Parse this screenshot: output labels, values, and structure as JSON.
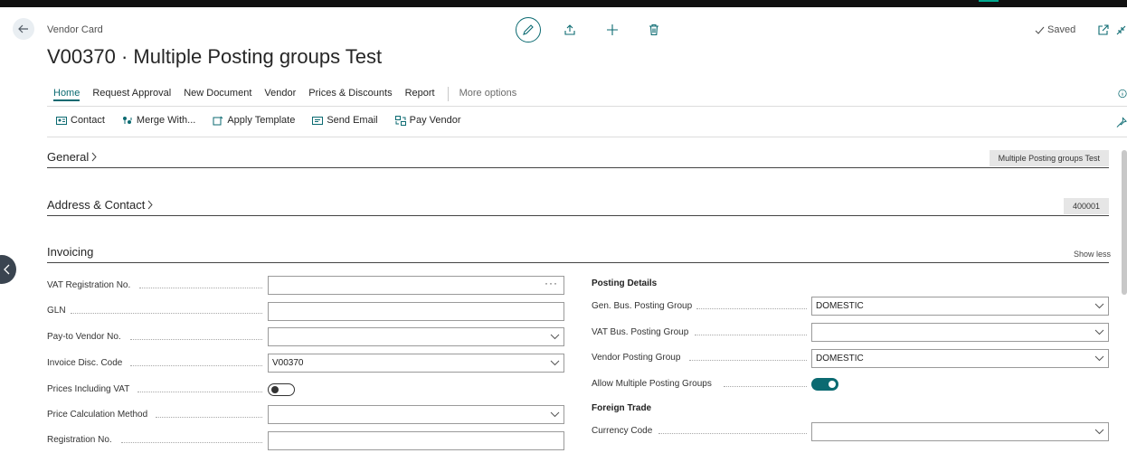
{
  "header": {
    "caption": "Vendor Card",
    "title": "V00370 · Multiple Posting groups Test",
    "saved_label": "Saved"
  },
  "menu": {
    "items": [
      "Home",
      "Request Approval",
      "New Document",
      "Vendor",
      "Prices & Discounts",
      "Report"
    ],
    "more_options": "More options"
  },
  "actions": {
    "items": [
      "Contact",
      "Merge With...",
      "Apply Template",
      "Send Email",
      "Pay Vendor"
    ]
  },
  "sections": {
    "general": {
      "title": "General",
      "summary": "Multiple Posting groups Test"
    },
    "address": {
      "title": "Address & Contact",
      "summary": "400001"
    },
    "invoicing": {
      "title": "Invoicing",
      "show_less": "Show less"
    }
  },
  "invoicing_left": [
    {
      "label": "VAT Registration No.",
      "value": "",
      "control": "ellipsis"
    },
    {
      "label": "GLN",
      "value": "",
      "control": "text"
    },
    {
      "label": "Pay-to Vendor No.",
      "value": "",
      "control": "dropdown"
    },
    {
      "label": "Invoice Disc. Code",
      "value": "V00370",
      "control": "dropdown"
    },
    {
      "label": "Prices Including VAT",
      "value": "off",
      "control": "toggle"
    },
    {
      "label": "Price Calculation Method",
      "value": "",
      "control": "dropdown"
    },
    {
      "label": "Registration No.",
      "value": "",
      "control": "text"
    }
  ],
  "posting_details": {
    "title": "Posting Details",
    "fields": [
      {
        "label": "Gen. Bus. Posting Group",
        "value": "DOMESTIC",
        "control": "dropdown"
      },
      {
        "label": "VAT Bus. Posting Group",
        "value": "",
        "control": "dropdown"
      },
      {
        "label": "Vendor Posting Group",
        "value": "DOMESTIC",
        "control": "dropdown"
      },
      {
        "label": "Allow Multiple Posting Groups",
        "value": "on",
        "control": "toggle"
      }
    ]
  },
  "foreign_trade": {
    "title": "Foreign Trade",
    "fields": [
      {
        "label": "Currency Code",
        "value": "",
        "control": "dropdown"
      }
    ]
  },
  "colors": {
    "accent": "#0b6a71",
    "border": "#9a9a9a",
    "badge_bg": "#e6e6e6"
  }
}
